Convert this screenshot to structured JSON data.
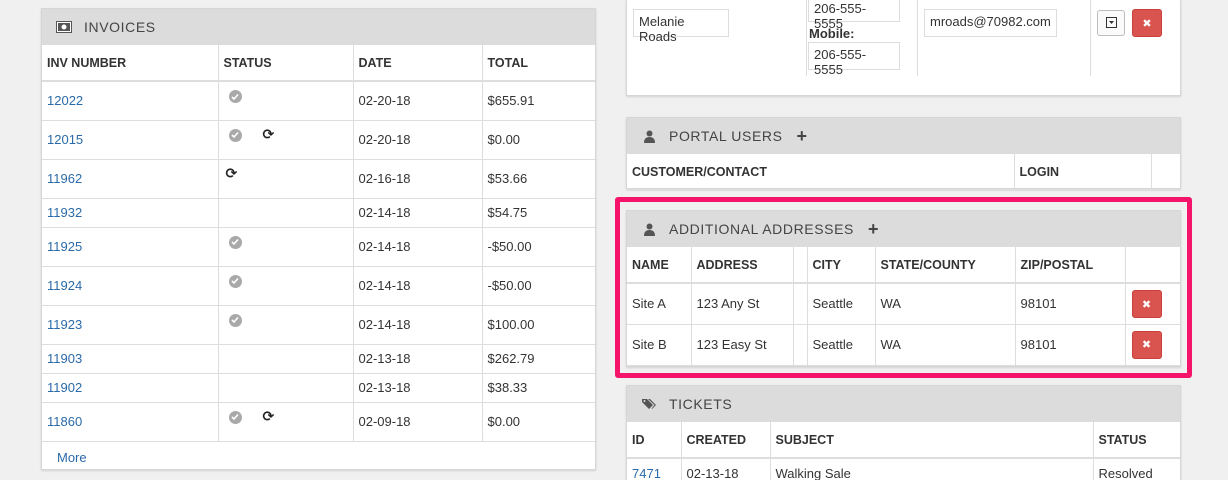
{
  "invoices": {
    "title": "INVOICES",
    "columns": [
      "INV NUMBER",
      "STATUS",
      "DATE",
      "TOTAL"
    ],
    "rows": [
      {
        "number": "12022",
        "date": "02-20-18",
        "total": "$655.91"
      },
      {
        "number": "12015",
        "date": "02-20-18",
        "total": "$0.00"
      },
      {
        "number": "11962",
        "date": "02-16-18",
        "total": "$53.66"
      },
      {
        "number": "11932",
        "date": "02-14-18",
        "total": "$54.75"
      },
      {
        "number": "11925",
        "date": "02-14-18",
        "total": "-$50.00"
      },
      {
        "number": "11924",
        "date": "02-14-18",
        "total": "-$50.00"
      },
      {
        "number": "11923",
        "date": "02-14-18",
        "total": "$100.00"
      },
      {
        "number": "11903",
        "date": "02-13-18",
        "total": "$262.79"
      },
      {
        "number": "11902",
        "date": "02-13-18",
        "total": "$38.33"
      },
      {
        "number": "11860",
        "date": "02-09-18",
        "total": "$0.00"
      }
    ],
    "more_label": "More"
  },
  "contact": {
    "name": "Melanie Roads",
    "phone": "206-555-5555",
    "mobile_label": "Mobile:",
    "mobile": "206-555-5555",
    "email": "mroads@70982.com"
  },
  "portal_users": {
    "title": "PORTAL USERS",
    "columns": [
      "CUSTOMER/CONTACT",
      "LOGIN"
    ]
  },
  "addresses": {
    "title": "ADDITIONAL ADDRESSES",
    "columns": [
      "NAME",
      "ADDRESS",
      "CITY",
      "STATE/COUNTY",
      "ZIP/POSTAL"
    ],
    "rows": [
      {
        "name": "Site A",
        "address": "123 Any St",
        "city": "Seattle",
        "state": "WA",
        "zip": "98101"
      },
      {
        "name": "Site B",
        "address": "123 Easy St",
        "city": "Seattle",
        "state": "WA",
        "zip": "98101"
      }
    ]
  },
  "tickets": {
    "title": "TICKETS",
    "columns": [
      "ID",
      "CREATED",
      "SUBJECT",
      "STATUS"
    ],
    "rows": [
      {
        "id": "7471",
        "created": "02-13-18",
        "subject": "Walking Sale",
        "status": "Resolved"
      }
    ]
  },
  "colors": {
    "highlight": "#f5146a",
    "delete_button": "#d9534f",
    "link": "#2a6aa8"
  },
  "icons": {
    "invoices": "money-icon",
    "users": "user-icon",
    "tickets": "tags-icon",
    "status_paid": "check-circle-icon",
    "status_recurring": "refresh-icon",
    "delete": "times-icon"
  }
}
